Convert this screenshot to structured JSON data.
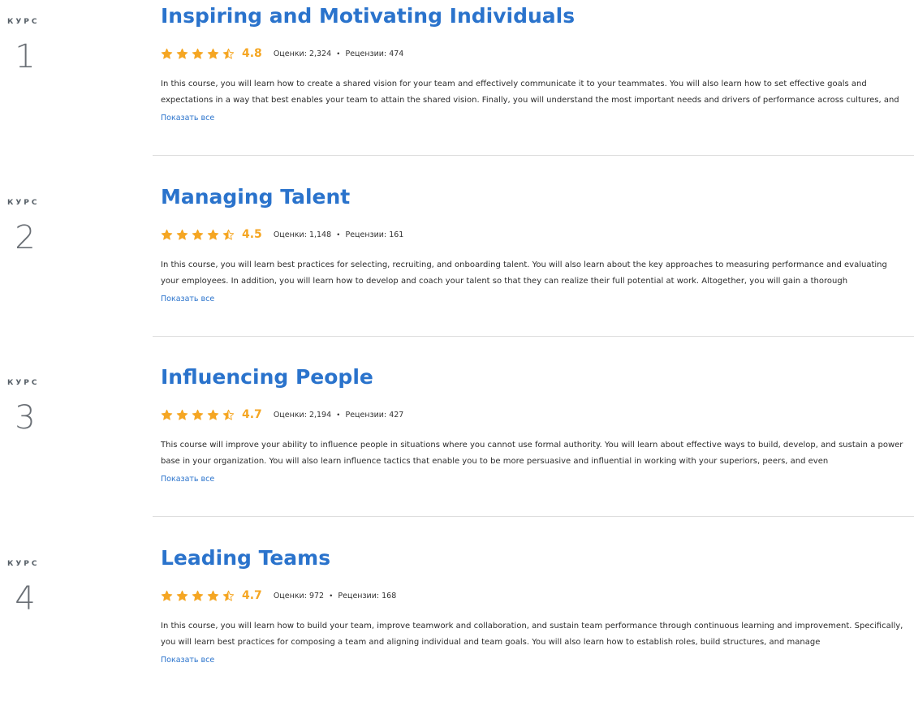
{
  "colors": {
    "title": "#2a73cc",
    "star": "#f5a623",
    "link": "#2a73cc",
    "divider": "#dedede"
  },
  "courses": [
    {
      "label": "КУРС",
      "number": "1",
      "title": "Inspiring and Motivating Individuals",
      "rating": "4.8",
      "stars_filled": 4.5,
      "ratings_count": "Оценки: 2,324",
      "separator": "•",
      "reviews_count": "Рецензии: 474",
      "description": "In this course, you will learn how to create a shared vision for your team and effectively communicate it to your teammates. You will also learn how to set effective goals and expectations in a way that best enables your team to attain the shared vision. Finally, you will understand the most important needs and drivers of performance across cultures, and",
      "show_all": "Показать все"
    },
    {
      "label": "КУРС",
      "number": "2",
      "title": "Managing Talent",
      "rating": "4.5",
      "stars_filled": 4.5,
      "ratings_count": "Оценки: 1,148",
      "separator": "•",
      "reviews_count": "Рецензии: 161",
      "description": "In this course, you will learn best practices for selecting, recruiting, and onboarding talent. You will also learn about the key approaches to measuring performance and evaluating your employees. In addition, you will learn how to develop and coach your talent so that they can realize their full potential at work. Altogether, you will gain a thorough",
      "show_all": "Показать все"
    },
    {
      "label": "КУРС",
      "number": "3",
      "title": "Influencing People",
      "rating": "4.7",
      "stars_filled": 4.5,
      "ratings_count": "Оценки: 2,194",
      "separator": "•",
      "reviews_count": "Рецензии: 427",
      "description": "This course will improve your ability to influence people in situations where you cannot use formal authority. You will learn about effective ways to build, develop, and sustain a power base in your organization. You will also learn influence tactics that enable you to be more persuasive and influential in working with your superiors, peers, and even",
      "show_all": "Показать все"
    },
    {
      "label": "КУРС",
      "number": "4",
      "title": "Leading Teams",
      "rating": "4.7",
      "stars_filled": 4.5,
      "ratings_count": "Оценки: 972",
      "separator": "•",
      "reviews_count": "Рецензии: 168",
      "description": "In this course, you will learn how to build your team, improve teamwork and collaboration, and sustain team performance through continuous learning and improvement. Specifically, you will learn best practices for composing a team and aligning individual and team goals. You will also learn how to establish roles, build structures, and manage",
      "show_all": "Показать все"
    }
  ]
}
